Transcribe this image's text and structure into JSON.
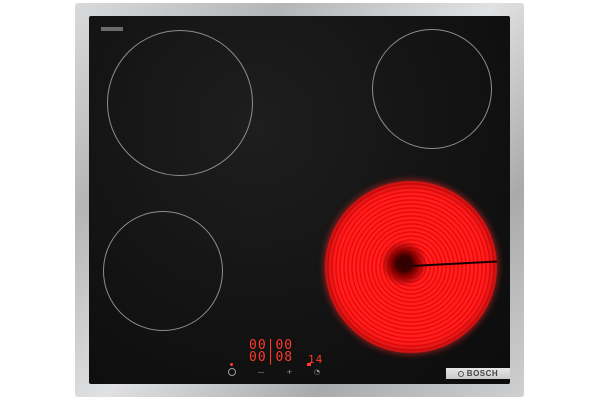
{
  "product": {
    "brand": "BOSCH",
    "frame_color": "#c0c2c4",
    "glass_color": "#121212",
    "hot_zone_color": "#ff1a1a"
  },
  "display": {
    "row1": "00|00",
    "row2": "00|08",
    "row2_extra": "14",
    "color": "#ff3a2a"
  },
  "controls": [
    {
      "icon": "power-icon"
    },
    {
      "icon": "minus-icon",
      "label": "—"
    },
    {
      "icon": "plus-icon",
      "label": "+"
    },
    {
      "icon": "timer-icon",
      "label": "◔"
    }
  ],
  "zones": [
    {
      "name": "cooking-zone-top-left",
      "state": "off"
    },
    {
      "name": "cooking-zone-top-right",
      "state": "off"
    },
    {
      "name": "cooking-zone-bottom-left",
      "state": "off"
    },
    {
      "name": "cooking-zone-bottom-right",
      "state": "on"
    }
  ]
}
